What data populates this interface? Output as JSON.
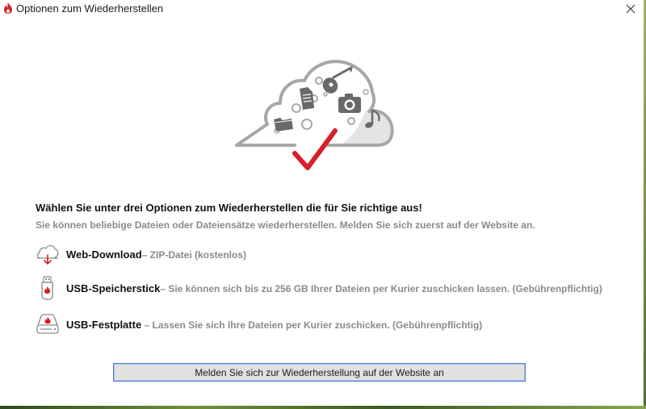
{
  "window": {
    "title": "Optionen zum Wiederherstellen",
    "close_icon": "close-icon",
    "app_icon": "backblaze-flame-icon"
  },
  "colors": {
    "accent_red": "#d71f26",
    "heading_text": "#111111",
    "secondary_text": "#8a8a8a",
    "button_border": "#4a79c4",
    "button_bg": "#e1e1e1"
  },
  "hero": {
    "icons": [
      "cloud-icon",
      "document-icon",
      "guitar-icon",
      "camera-icon",
      "folder-icon",
      "music-note-icon",
      "checkmark-icon"
    ]
  },
  "main": {
    "heading": "Wählen Sie unter drei Optionen zum Wiederherstellen die für Sie richtige aus!",
    "subheading": "Sie können beliebige Dateien oder Dateiensätze wiederherstellen.  Melden Sie sich zuerst auf der Website an."
  },
  "options": [
    {
      "icon": "cloud-download-icon",
      "name": "Web-Download",
      "desc": "– ZIP-Datei (kostenlos)"
    },
    {
      "icon": "usb-stick-icon",
      "name": "USB-Speicherstick",
      "desc": "– Sie können sich bis zu 256 GB Ihrer Dateien per Kurier zuschicken lassen.  (Gebührenpflichtig)"
    },
    {
      "icon": "usb-hard-drive-icon",
      "name": "USB-Festplatte",
      "desc": " – Lassen Sie sich Ihre Dateien per Kurier zuschicken.  (Gebührenpflichtig)"
    }
  ],
  "footer": {
    "login_button": "Melden Sie sich zur Wiederherstellung auf der Website an"
  }
}
